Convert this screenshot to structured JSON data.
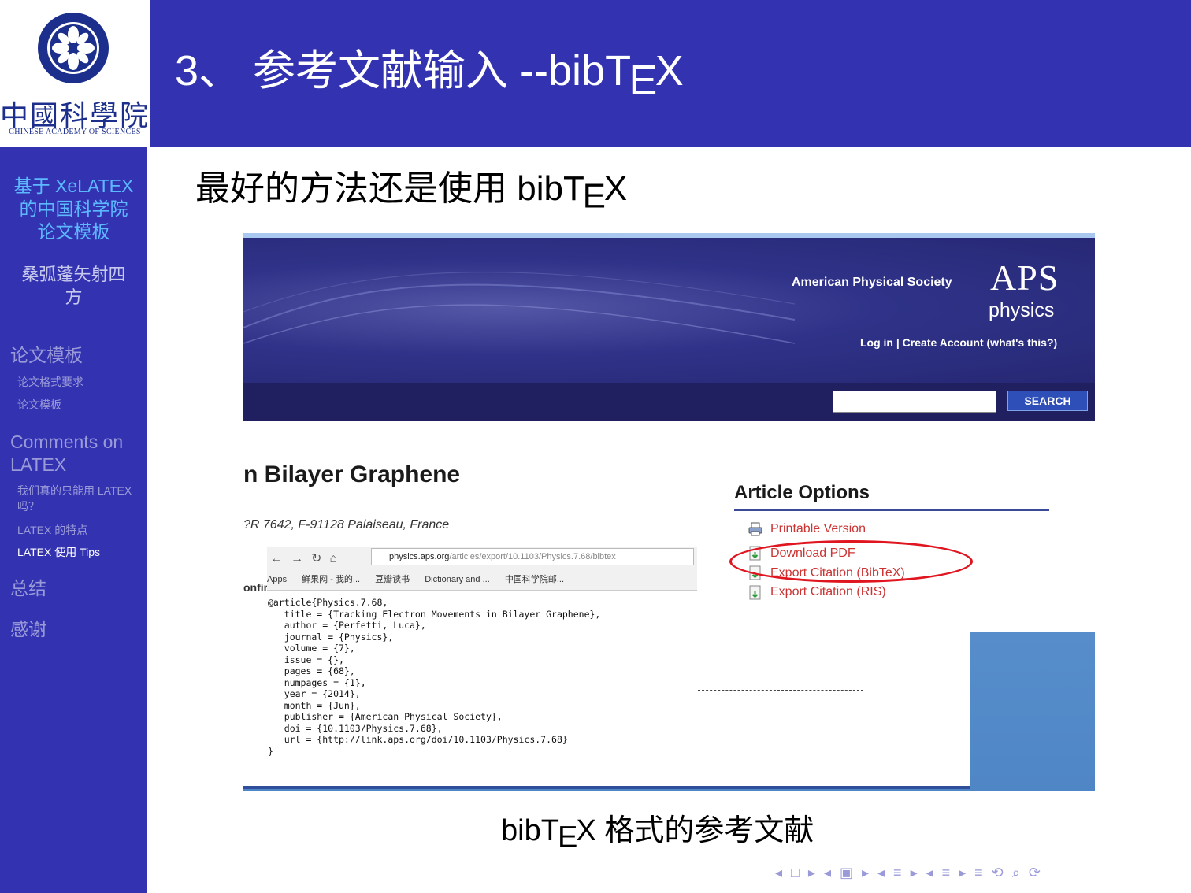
{
  "logo": {
    "name_cn": "中國科學院",
    "name_en": "CHINESE ACADEMY OF SCIENCES"
  },
  "sidebar": {
    "title_lines": [
      "基于 XeLATEX",
      "的中国科学院",
      "论文模板"
    ],
    "author_lines": [
      "桑弧蓬矢射四",
      "方"
    ],
    "sections": [
      {
        "label": "论文模板",
        "subs": [
          "论文格式要求",
          "论文模板"
        ]
      },
      {
        "label_lines": [
          "Comments on",
          "LATEX"
        ],
        "subs": [
          "我们真的只能用 LATEX",
          "吗？",
          "LATEX 的特点",
          "LATEX 使用 Tips"
        ]
      },
      {
        "label": "总结"
      },
      {
        "label": "感谢"
      }
    ]
  },
  "slide": {
    "title_prefix": "3、 参考文献输入 --bibT",
    "title_e": "E",
    "title_x": "X",
    "body_prefix": "最好的方法还是使用 bibT",
    "body_e": "E",
    "body_x": "X",
    "caption_prefix": "bibT",
    "caption_e": "E",
    "caption_x": "X 格式的参考文献"
  },
  "aps": {
    "society": "American Physical Society",
    "logo": "APS",
    "physics": "physics",
    "links": "Log in  |  Create Account (what's this?)",
    "search_button": "SEARCH",
    "article_title": "n Bilayer Graphene",
    "affiliation": "?R 7642, F-91128 Palaiseau, France",
    "confirm": "onfir",
    "options_title": "Article Options",
    "options": [
      "Printable Version",
      "Download PDF",
      "Export Citation (BibTeX)",
      "Export Citation (RIS)"
    ]
  },
  "browser": {
    "url_host": "physics.aps.org",
    "url_path": "/articles/export/10.1103/Physics.7.68/bibtex",
    "bookmarks": [
      "Apps",
      "鲜果网 - 我的...",
      "豆瓣读书",
      "Dictionary and ...",
      "中国科学院邮..."
    ]
  },
  "bibtex_text": "@article{Physics.7.68,\n   title = {Tracking Electron Movements in Bilayer Graphene},\n   author = {Perfetti, Luca},\n   journal = {Physics},\n   volume = {7},\n   issue = {},\n   pages = {68},\n   numpages = {1},\n   year = {2014},\n   month = {Jun},\n   publisher = {American Physical Society},\n   doi = {10.1103/Physics.7.68},\n   url = {http://link.aps.org/doi/10.1103/Physics.7.68}\n}",
  "beamer_nav": "◂ □ ▸ ◂ ▣ ▸ ◂ ≡ ▸ ◂ ≡ ▸   ≡   ⟲ ⌕ ⟳",
  "colors": {
    "theme_blue": "#3333b2",
    "title_cyan": "#5cb8ff",
    "highlight_red": "#e0151f",
    "option_red": "#cc3333"
  }
}
